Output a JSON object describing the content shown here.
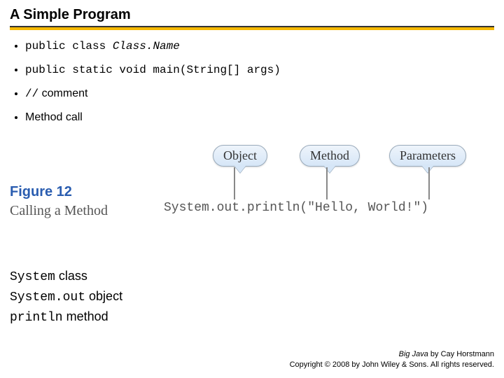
{
  "title": "A Simple Program",
  "bullets": {
    "b1_prefix": "public class ",
    "b1_classname": "Class.Name",
    "b2": "public static void main(String[] args)",
    "b3_code": "//",
    "b3_text": " comment",
    "b4": "Method call"
  },
  "figure": {
    "number": "Figure 12",
    "caption": "Calling a Method",
    "bubble_object": "Object",
    "bubble_method": "Method",
    "bubble_params": "Parameters",
    "code": "System.out.println(\"Hello, World!\")"
  },
  "summary": {
    "l1_code": "System",
    "l1_text": " class",
    "l2_code": "System.out",
    "l2_text": " object",
    "l3_code": "println",
    "l3_text": " method"
  },
  "footer": {
    "book": "Big Java",
    "author": " by Cay Horstmann",
    "copyright": "Copyright © 2008 by John Wiley & Sons. All rights reserved."
  }
}
